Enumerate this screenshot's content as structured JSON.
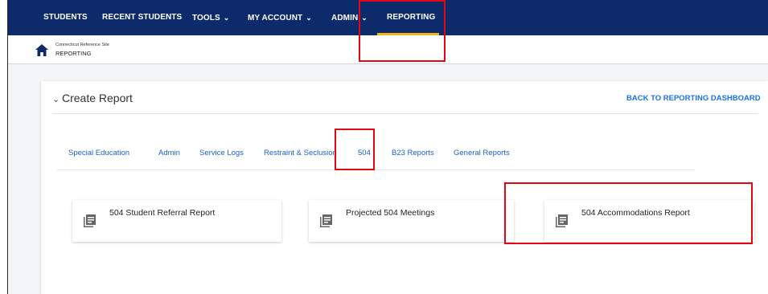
{
  "nav": {
    "items": [
      {
        "label": "STUDENTS",
        "dropdown": false
      },
      {
        "label": "RECENT STUDENTS",
        "dropdown": false
      },
      {
        "label": "TOOLS",
        "dropdown": true
      },
      {
        "label": "MY ACCOUNT",
        "dropdown": true
      },
      {
        "label": "ADMIN",
        "dropdown": true
      },
      {
        "label": "REPORTING",
        "dropdown": false,
        "active": true
      }
    ],
    "chevron": "⌄"
  },
  "breadcrumb": {
    "site": "Connecticut Reference Site",
    "page": "REPORTING",
    "icon": "home-icon"
  },
  "panel": {
    "caret": "⌄",
    "title": "Create Report",
    "back_link": "BACK TO REPORTING DASHBOARD"
  },
  "tabs": [
    {
      "label": "Special Education"
    },
    {
      "label": "Admin"
    },
    {
      "label": "Service Logs"
    },
    {
      "label": "Restraint & Seclusion"
    },
    {
      "label": "504",
      "selected": true
    },
    {
      "label": "B23 Reports"
    },
    {
      "label": "General Reports"
    }
  ],
  "reports": [
    {
      "label": "504 Student Referral Report",
      "icon": "report-list-icon"
    },
    {
      "label": "Projected 504 Meetings",
      "icon": "report-list-icon"
    },
    {
      "label": "504 Accommodations Report",
      "icon": "report-list-icon"
    }
  ],
  "colors": {
    "nav_bg": "#0d2b6b",
    "active_underline": "#f2b51e",
    "link_blue": "#1a73e8",
    "highlight_red": "#e30613"
  }
}
